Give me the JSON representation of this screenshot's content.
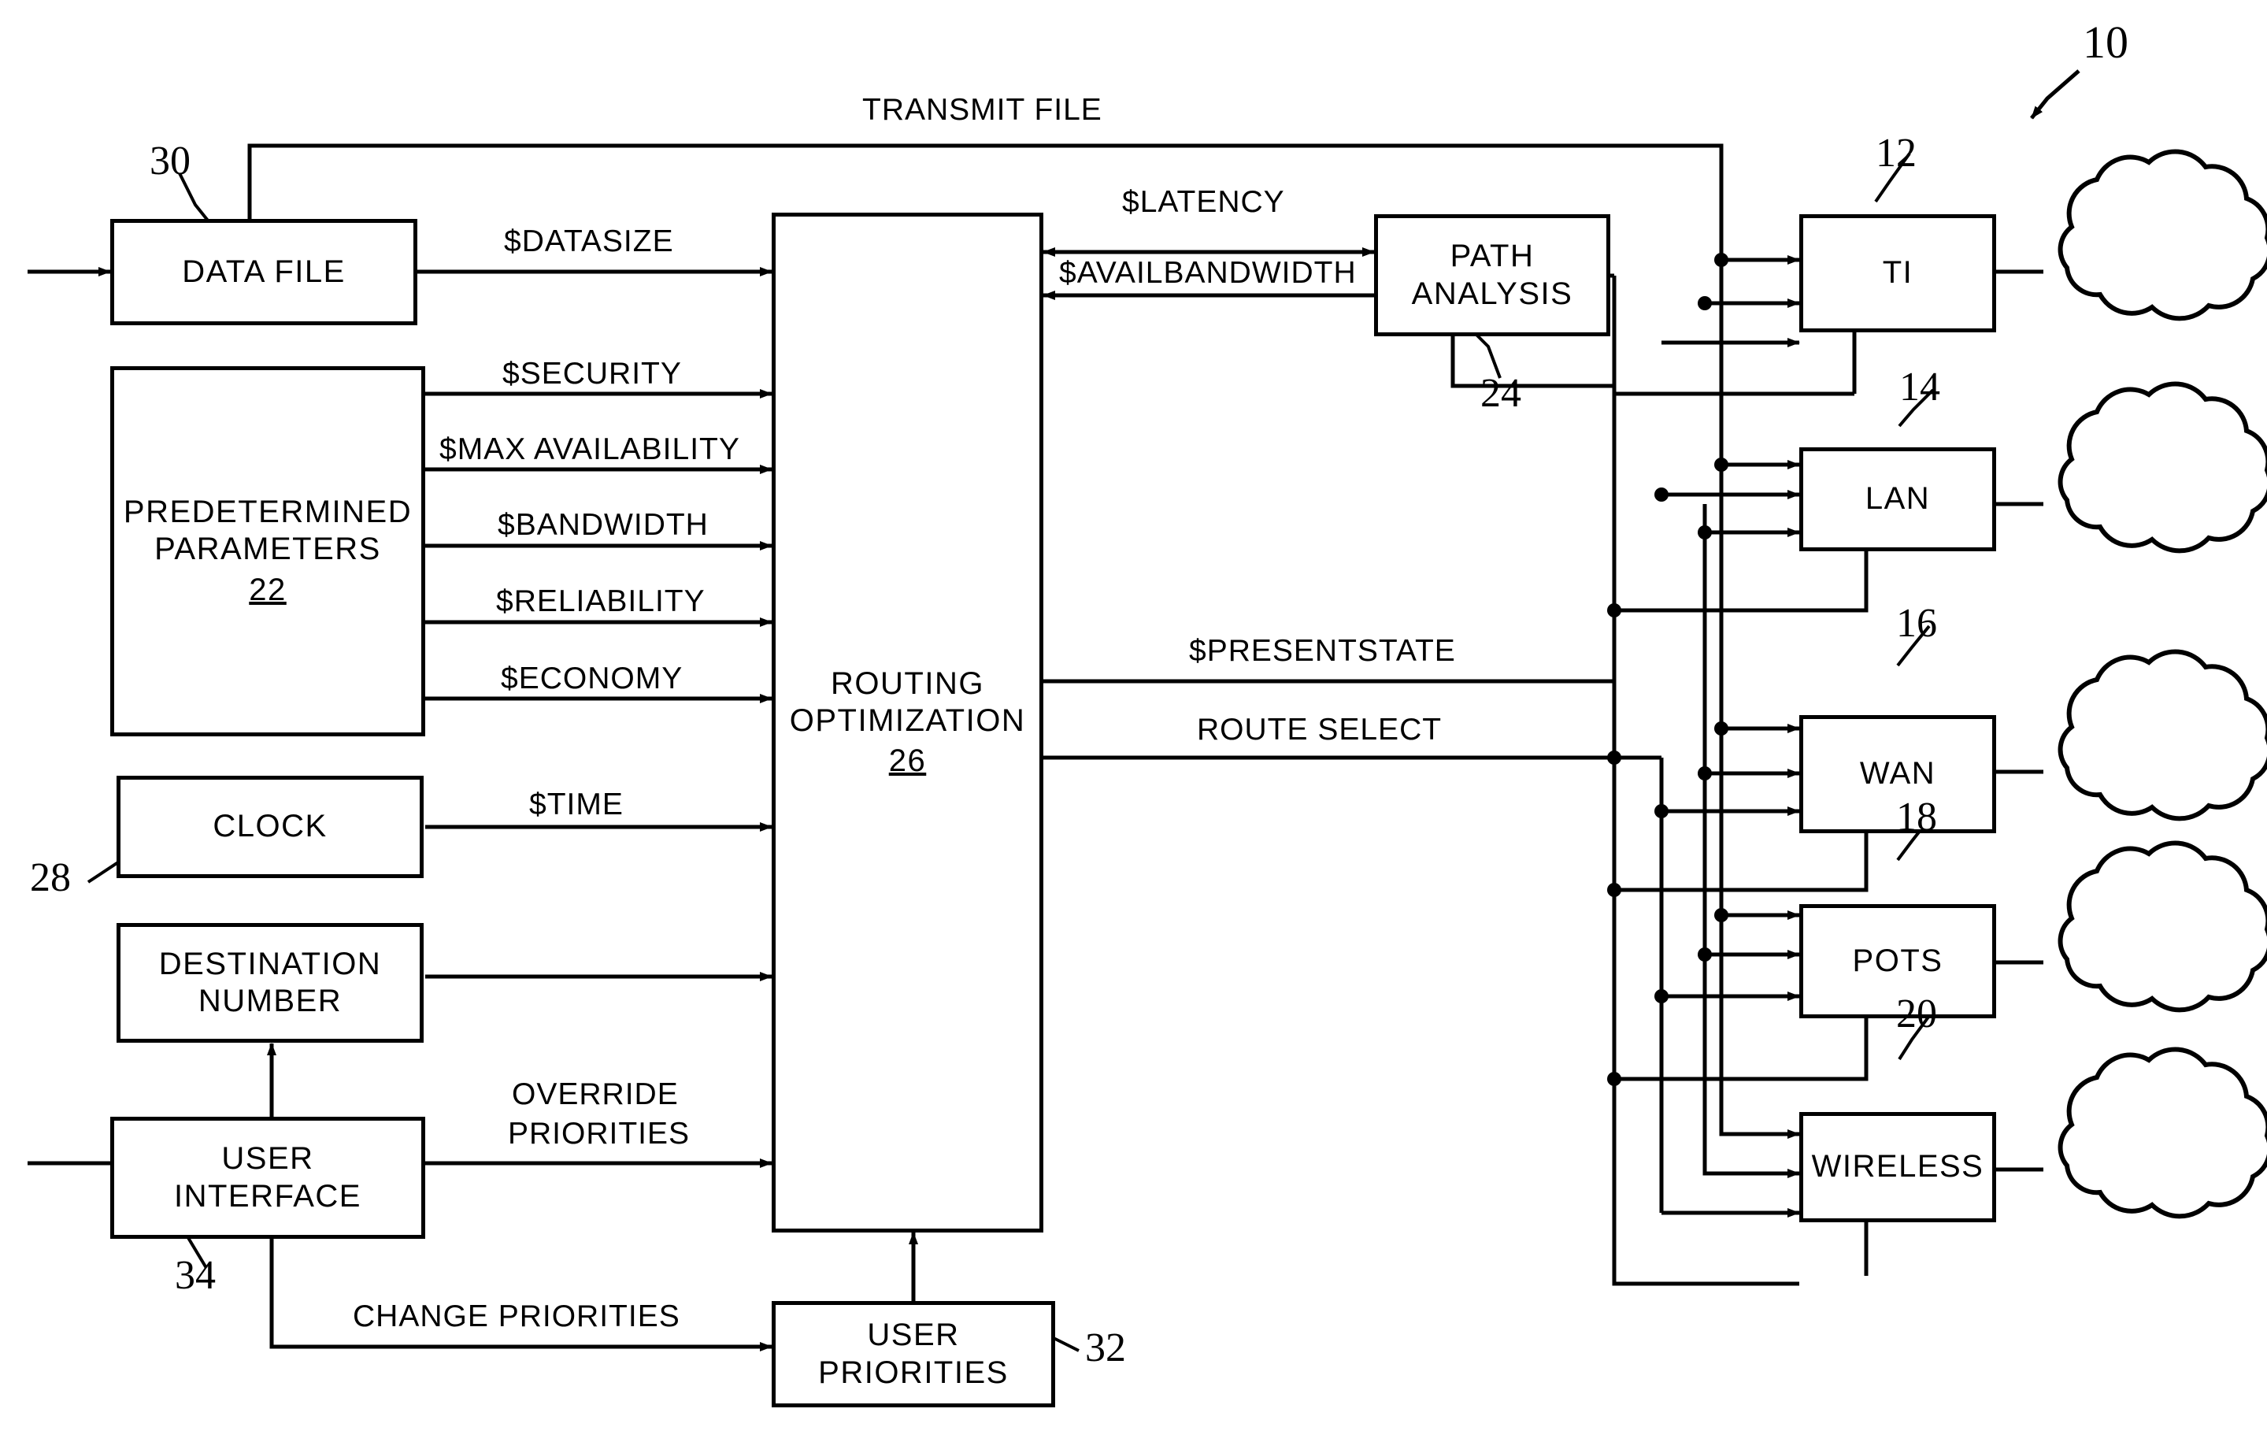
{
  "figure": {
    "figure_ref": "10",
    "title_label": "TRANSMIT FILE"
  },
  "boxes": {
    "data_file": {
      "label": "DATA FILE",
      "ref": "30"
    },
    "predetermined_parameters": {
      "line1": "PREDETERMINED",
      "line2": "PARAMETERS",
      "ref": "22"
    },
    "clock": {
      "label": "CLOCK",
      "ref": "28"
    },
    "destination_number": {
      "line1": "DESTINATION",
      "line2": "NUMBER"
    },
    "user_interface": {
      "line1": "USER",
      "line2": "INTERFACE",
      "ref": "34"
    },
    "user_priorities": {
      "line1": "USER",
      "line2": "PRIORITIES",
      "ref": "32"
    },
    "routing_optimization": {
      "line1": "ROUTING",
      "line2": "OPTIMIZATION",
      "ref": "26"
    },
    "path_analysis": {
      "line1": "PATH",
      "line2": "ANALYSIS",
      "ref": "24"
    },
    "ti": {
      "label": "TI",
      "ref": "12"
    },
    "lan": {
      "label": "LAN",
      "ref": "14"
    },
    "wan": {
      "label": "WAN",
      "ref": "16"
    },
    "pots": {
      "label": "POTS",
      "ref": "18"
    },
    "wireless": {
      "label": "WIRELESS",
      "ref": "20"
    }
  },
  "signals": {
    "transmit_file": "TRANSMIT FILE",
    "datasize": "$DATASIZE",
    "security": "$SECURITY",
    "max_availability": "$MAX  AVAILABILITY",
    "bandwidth": "$BANDWIDTH",
    "reliability": "$RELIABILITY",
    "economy": "$ECONOMY",
    "time": "$TIME",
    "override_priorities_l1": "OVERRIDE",
    "override_priorities_l2": "PRIORITIES",
    "change_priorities": "CHANGE  PRIORITIES",
    "latency": "$LATENCY",
    "availbandwidth": "$AVAILBANDWIDTH",
    "presentstate": "$PRESENTSTATE",
    "route_select": "ROUTE  SELECT"
  },
  "style": {
    "line_color": "#000000",
    "background": "#ffffff"
  }
}
